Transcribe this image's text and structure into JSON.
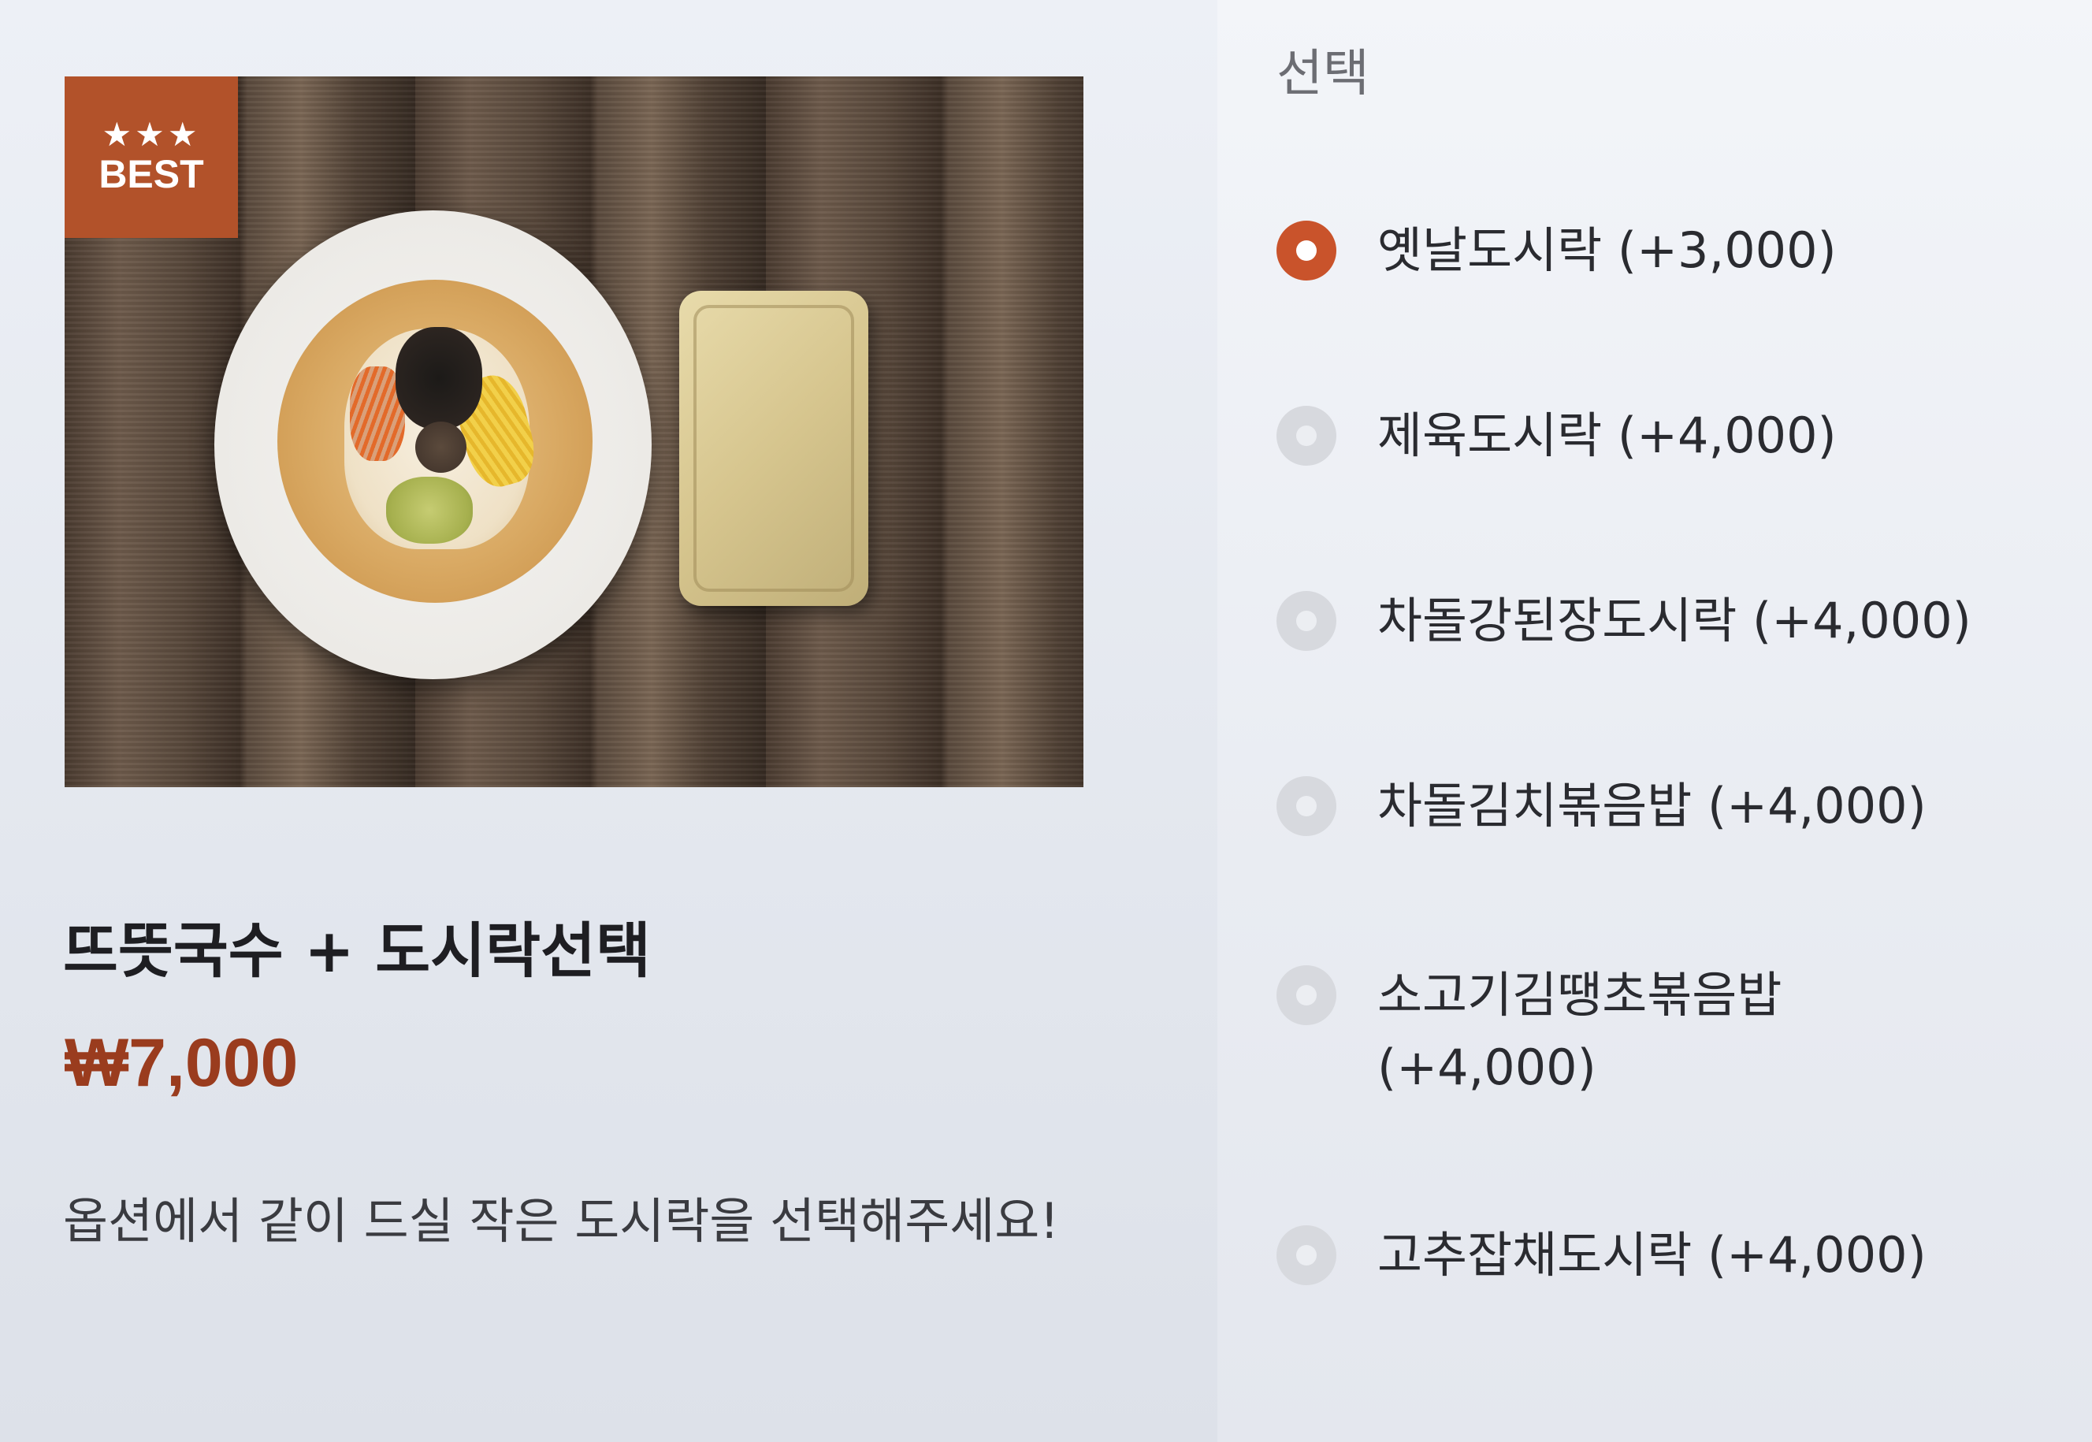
{
  "product": {
    "badge_stars": "★★★",
    "badge_text": "BEST",
    "title": "뜨뜻국수 + 도시락선택",
    "price": "₩7,000",
    "description": "옵션에서 같이 드실 작은 도시락을 선택해주세요!"
  },
  "options": {
    "heading": "선택",
    "items": [
      {
        "label": "옛날도시락 (+3,000)",
        "selected": true
      },
      {
        "label": "제육도시락 (+4,000)",
        "selected": false
      },
      {
        "label": "차돌강된장도시락 (+4,000)",
        "selected": false
      },
      {
        "label": "차돌김치볶음밥 (+4,000)",
        "selected": false
      },
      {
        "label": "소고기김땡초볶음밥 (+4,000)",
        "selected": false
      },
      {
        "label": "고추잡채도시락 (+4,000)",
        "selected": false
      }
    ]
  },
  "colors": {
    "accent": "#c9532b",
    "price": "#9a3c1e",
    "badge": "#b2522a"
  }
}
